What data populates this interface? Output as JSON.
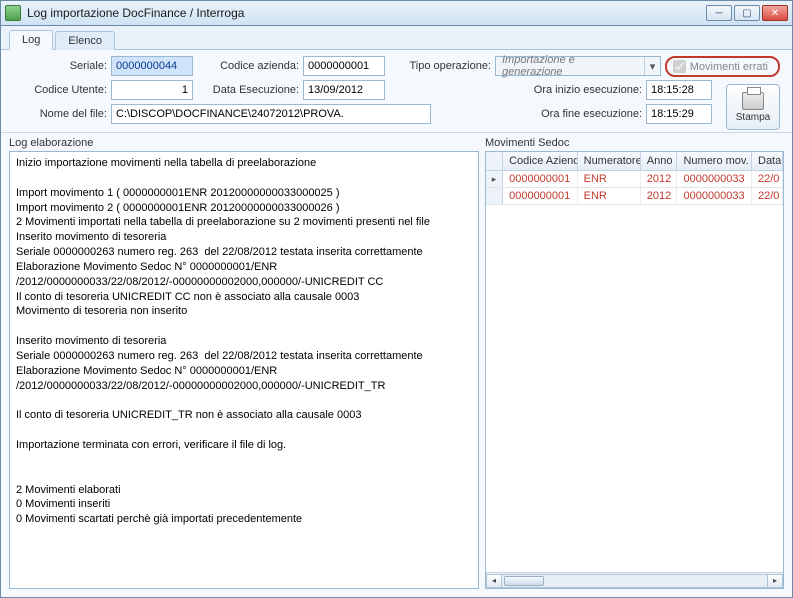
{
  "window": {
    "title": "Log importazione DocFinance / Interroga"
  },
  "tabs": [
    {
      "label": "Log",
      "active": true
    },
    {
      "label": "Elenco",
      "active": false
    }
  ],
  "form": {
    "seriale_label": "Seriale:",
    "seriale_value": "0000000044",
    "codice_azienda_label": "Codice azienda:",
    "codice_azienda_value": "0000000001",
    "tipo_operazione_label": "Tipo operazione:",
    "tipo_operazione_value": "Importazione e generazione",
    "movimenti_errati_label": "Movimenti errati",
    "codice_utente_label": "Codice Utente:",
    "codice_utente_value": "1",
    "data_esecuzione_label": "Data Esecuzione:",
    "data_esecuzione_value": "13/09/2012",
    "ora_inizio_label": "Ora inizio esecuzione:",
    "ora_inizio_value": "18:15:28",
    "nome_file_label": "Nome del file:",
    "nome_file_value": "C:\\DISCOP\\DOCFINANCE\\24072012\\PROVA.",
    "ora_fine_label": "Ora fine esecuzione:",
    "ora_fine_value": "18:15:29",
    "stampa_label": "Stampa"
  },
  "log": {
    "title": "Log elaborazione",
    "text": "Inizio importazione movimenti nella tabella di preelaborazione\n\nImport movimento 1 ( 0000000001ENR 20120000000033000025 )\nImport movimento 2 ( 0000000001ENR 20120000000033000026 )\n2 Movimenti importati nella tabella di preelaborazione su 2 movimenti presenti nel file\nInserito movimento di tesoreria\nSeriale 0000000263 numero reg. 263  del 22/08/2012 testata inserita correttamente\nElaborazione Movimento Sedoc N° 0000000001/ENR /2012/0000000033/22/08/2012/-00000000002000,000000/-UNICREDIT CC\nIl conto di tesoreria UNICREDIT CC non è associato alla causale 0003\nMovimento di tesoreria non inserito\n\nInserito movimento di tesoreria\nSeriale 0000000263 numero reg. 263  del 22/08/2012 testata inserita correttamente\nElaborazione Movimento Sedoc N° 0000000001/ENR /2012/0000000033/22/08/2012/-00000000002000,000000/-UNICREDIT_TR\n\nIl conto di tesoreria UNICREDIT_TR non è associato alla causale 0003\n\nImportazione terminata con errori, verificare il file di log.\n\n\n2 Movimenti elaborati\n0 Movimenti inseriti\n0 Movimenti scartati perchè già importati precedentemente"
  },
  "grid": {
    "title": "Movimenti Sedoc",
    "headers": [
      "Codice Azienda",
      "Numeratore",
      "Anno",
      "Numero mov.",
      "Data"
    ],
    "rows": [
      {
        "codice": "0000000001",
        "numeratore": "ENR",
        "anno": "2012",
        "nummov": "0000000033",
        "data": "22/0"
      },
      {
        "codice": "0000000001",
        "numeratore": "ENR",
        "anno": "2012",
        "nummov": "0000000033",
        "data": "22/0"
      }
    ]
  }
}
